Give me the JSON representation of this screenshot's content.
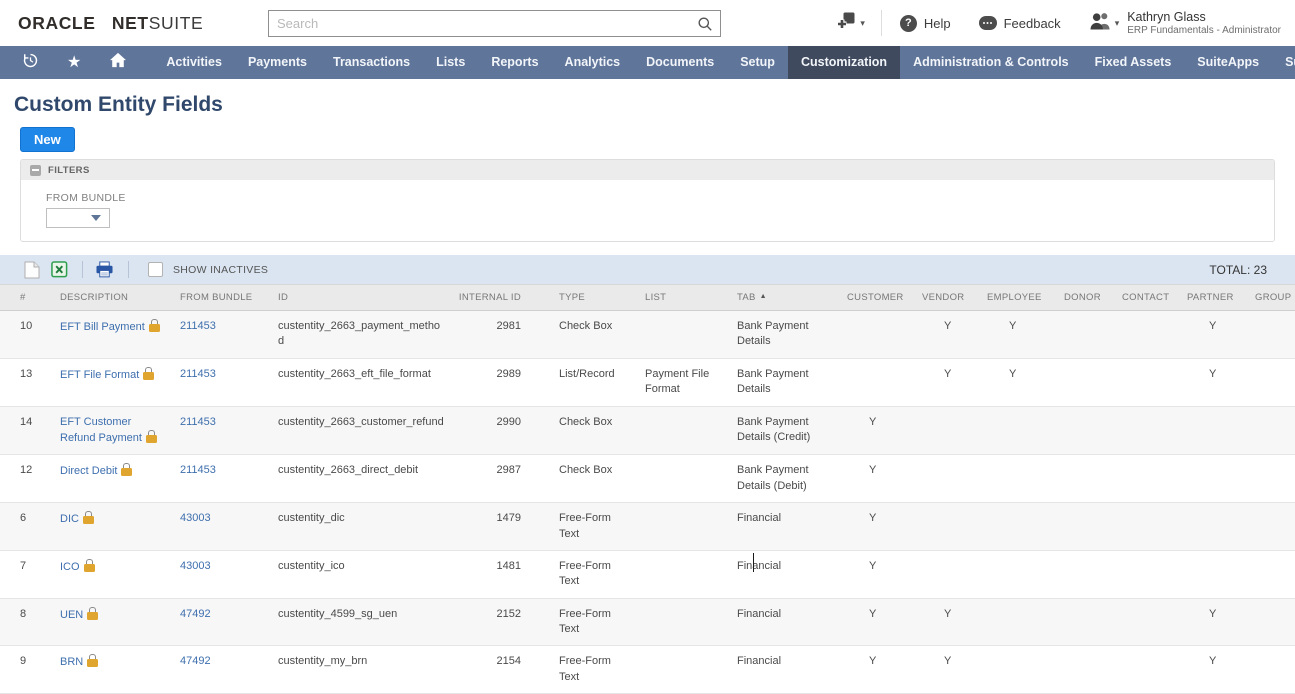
{
  "header": {
    "logo_oracle": "ORACLE",
    "logo_net": "NET",
    "logo_suite": "SUITE",
    "search_placeholder": "Search",
    "help_label": "Help",
    "feedback_label": "Feedback",
    "user_name": "Kathryn Glass",
    "user_role": "ERP Fundamentals - Administrator"
  },
  "nav": {
    "active": "Customization",
    "items": [
      "Activities",
      "Payments",
      "Transactions",
      "Lists",
      "Reports",
      "Analytics",
      "Documents",
      "Setup",
      "Customization",
      "Administration & Controls",
      "Fixed Assets",
      "SuiteApps",
      "Support"
    ]
  },
  "page": {
    "title": "Custom Entity Fields",
    "new_button_label": "New",
    "filters_label": "FILTERS",
    "from_bundle_label": "FROM BUNDLE"
  },
  "toolbar": {
    "show_inactives_label": "SHOW INACTIVES",
    "total_label": "TOTAL: 23"
  },
  "table": {
    "columns": [
      "#",
      "DESCRIPTION",
      "FROM BUNDLE",
      "ID",
      "INTERNAL ID",
      "TYPE",
      "LIST",
      "TAB",
      "CUSTOMER",
      "VENDOR",
      "EMPLOYEE",
      "DONOR",
      "CONTACT",
      "PARTNER",
      "GROUP"
    ],
    "sort_column": "TAB",
    "rows": [
      {
        "num": "10",
        "description": "EFT Bill Payment",
        "locked": true,
        "from_bundle": "211453",
        "id": "custentity_2663_payment_method",
        "internal_id": "2981",
        "type": "Check Box",
        "list": "",
        "tab": "Bank Payment Details",
        "customer": "",
        "vendor": "Y",
        "employee": "Y",
        "donor": "",
        "contact": "",
        "partner": "Y",
        "group": ""
      },
      {
        "num": "13",
        "description": "EFT File Format",
        "locked": true,
        "from_bundle": "211453",
        "id": "custentity_2663_eft_file_format",
        "internal_id": "2989",
        "type": "List/Record",
        "list": "Payment File Format",
        "tab": "Bank Payment Details",
        "customer": "",
        "vendor": "Y",
        "employee": "Y",
        "donor": "",
        "contact": "",
        "partner": "Y",
        "group": ""
      },
      {
        "num": "14",
        "description": "EFT Customer Refund Payment",
        "locked": true,
        "from_bundle": "211453",
        "id": "custentity_2663_customer_refund",
        "internal_id": "2990",
        "type": "Check Box",
        "list": "",
        "tab": "Bank Payment Details (Credit)",
        "customer": "Y",
        "vendor": "",
        "employee": "",
        "donor": "",
        "contact": "",
        "partner": "",
        "group": ""
      },
      {
        "num": "12",
        "description": "Direct Debit",
        "locked": true,
        "from_bundle": "211453",
        "id": "custentity_2663_direct_debit",
        "internal_id": "2987",
        "type": "Check Box",
        "list": "",
        "tab": "Bank Payment Details (Debit)",
        "customer": "Y",
        "vendor": "",
        "employee": "",
        "donor": "",
        "contact": "",
        "partner": "",
        "group": ""
      },
      {
        "num": "6",
        "description": "DIC",
        "locked": true,
        "from_bundle": "43003",
        "id": "custentity_dic",
        "internal_id": "1479",
        "type": "Free-Form Text",
        "list": "",
        "tab": "Financial",
        "customer": "Y",
        "vendor": "",
        "employee": "",
        "donor": "",
        "contact": "",
        "partner": "",
        "group": ""
      },
      {
        "num": "7",
        "description": "ICO",
        "locked": true,
        "from_bundle": "43003",
        "id": "custentity_ico",
        "internal_id": "1481",
        "type": "Free-Form Text",
        "list": "",
        "tab": "Financial",
        "customer": "Y",
        "vendor": "",
        "employee": "",
        "donor": "",
        "contact": "",
        "partner": "",
        "group": ""
      },
      {
        "num": "8",
        "description": "UEN",
        "locked": true,
        "from_bundle": "47492",
        "id": "custentity_4599_sg_uen",
        "internal_id": "2152",
        "type": "Free-Form Text",
        "list": "",
        "tab": "Financial",
        "customer": "Y",
        "vendor": "Y",
        "employee": "",
        "donor": "",
        "contact": "",
        "partner": "Y",
        "group": ""
      },
      {
        "num": "9",
        "description": "BRN",
        "locked": true,
        "from_bundle": "47492",
        "id": "custentity_my_brn",
        "internal_id": "2154",
        "type": "Free-Form Text",
        "list": "",
        "tab": "Financial",
        "customer": "Y",
        "vendor": "Y",
        "employee": "",
        "donor": "",
        "contact": "",
        "partner": "Y",
        "group": ""
      }
    ]
  },
  "icons": {
    "star": "★",
    "caret_down": "▾",
    "sort_asc": "▲",
    "help": "?"
  },
  "colors": {
    "nav_bg": "#60759a",
    "nav_active_bg": "#3f4a5e",
    "accent_blue": "#1f87e8",
    "link_color": "#3e6fae",
    "toolbar_bg": "#dbe5f1",
    "title_color": "#30486b",
    "lock_gold": "#e0a52f",
    "excel_green": "#2e9e4f",
    "print_blue": "#2a57a5"
  }
}
